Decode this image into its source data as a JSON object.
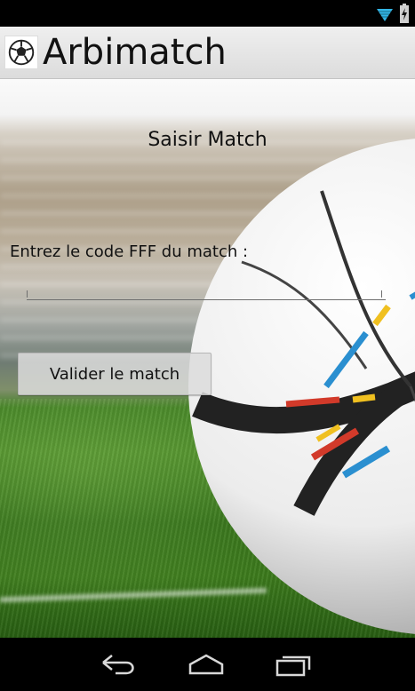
{
  "status_bar": {
    "icons": [
      "wifi-icon",
      "battery-icon"
    ]
  },
  "action_bar": {
    "title": "Arbimatch",
    "icon": "soccer-ball-app-icon"
  },
  "main": {
    "screen_title": "Saisir Match",
    "code_label": "Entrez le code FFF du match :",
    "code_value": "",
    "code_placeholder": "",
    "validate_label": "Valider le match"
  },
  "nav_bar": {
    "icons": [
      "back-icon",
      "home-icon",
      "recent-apps-icon"
    ]
  },
  "colors": {
    "action_bar_bg": "#e6e6e6",
    "nav_bg": "#000000",
    "status_icon": "#33b5e5"
  }
}
